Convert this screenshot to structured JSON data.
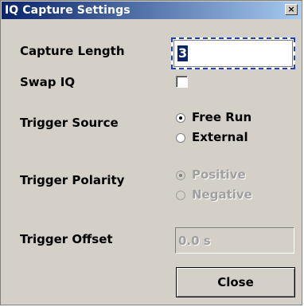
{
  "window": {
    "title": "IQ Capture Settings",
    "close_glyph": "×"
  },
  "capture_length": {
    "label": "Capture Length",
    "value": "3"
  },
  "swap_iq": {
    "label": "Swap IQ",
    "checked": false
  },
  "trigger_source": {
    "label": "Trigger Source",
    "options": [
      {
        "label": "Free Run",
        "selected": true,
        "enabled": true
      },
      {
        "label": "External",
        "selected": false,
        "enabled": true
      }
    ]
  },
  "trigger_polarity": {
    "label": "Trigger Polarity",
    "options": [
      {
        "label": "Positive",
        "selected": true,
        "enabled": false
      },
      {
        "label": "Negative",
        "selected": false,
        "enabled": false
      }
    ]
  },
  "trigger_offset": {
    "label": "Trigger Offset",
    "value": "0.0 s",
    "enabled": false
  },
  "close_button": {
    "label": "Close"
  },
  "colors": {
    "titlebar_start": "#0a246a",
    "titlebar_end": "#a6caf0",
    "dialog_bg": "#d4d0c8",
    "focus_border": "#1a3fcf"
  }
}
